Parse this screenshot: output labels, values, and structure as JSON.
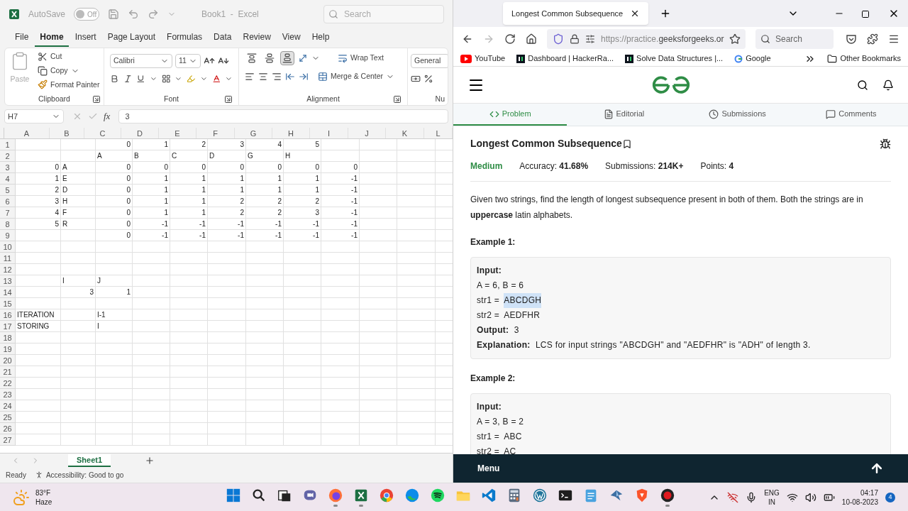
{
  "excel": {
    "title_bar": {
      "autosave_label": "AutoSave",
      "autosave_toggle": {
        "label": "Off",
        "on": false
      },
      "document_title": "Book1  -  Excel",
      "search": {
        "placeholder": "Search"
      }
    },
    "ribbon_tabs": [
      {
        "label": "File",
        "selected": false
      },
      {
        "label": "Home",
        "selected": true
      },
      {
        "label": "Insert",
        "selected": false
      },
      {
        "label": "Page Layout",
        "selected": false
      },
      {
        "label": "Formulas",
        "selected": false
      },
      {
        "label": "Data",
        "selected": false
      },
      {
        "label": "Review",
        "selected": false
      },
      {
        "label": "View",
        "selected": false
      },
      {
        "label": "Help",
        "selected": false
      }
    ],
    "ribbon": {
      "clipboard": {
        "paste": {
          "label": "Paste",
          "disabled": true
        },
        "cut": "Cut",
        "copy": "Copy",
        "format_painter": "Format Painter",
        "group_label": "Clipboard"
      },
      "font": {
        "family": "Calibri",
        "size": "11",
        "group_label": "Font"
      },
      "alignment": {
        "vertical": [
          {
            "kind": "top",
            "selected": false
          },
          {
            "kind": "middle",
            "selected": false
          },
          {
            "kind": "bottom",
            "selected": true
          }
        ],
        "wrap_text": "Wrap Text",
        "merge_center": "Merge & Center",
        "group_label": "Alignment"
      },
      "number": {
        "format": "General",
        "group_label": "Nu"
      }
    },
    "formula_bar": {
      "name_box": "H7",
      "function_label": "fx",
      "formula": "3"
    },
    "columns": [
      "A",
      "B",
      "C",
      "D",
      "E",
      "F",
      "G",
      "H",
      "I",
      "J",
      "K",
      "L"
    ],
    "rows": [
      {
        "row": "1",
        "cells": [
          null,
          null,
          {
            "text": "0",
            "kind": "number"
          },
          {
            "text": "1",
            "kind": "number"
          },
          {
            "text": "2",
            "kind": "number"
          },
          {
            "text": "3",
            "kind": "number"
          },
          {
            "text": "4",
            "kind": "number"
          },
          {
            "text": "5",
            "kind": "number"
          }
        ]
      },
      {
        "row": "2",
        "cells": [
          null,
          null,
          {
            "text": "A",
            "kind": "text"
          },
          {
            "text": "B",
            "kind": "text"
          },
          {
            "text": "C",
            "kind": "text"
          },
          {
            "text": "D",
            "kind": "text"
          },
          {
            "text": "G",
            "kind": "text"
          },
          {
            "text": "H",
            "kind": "text"
          }
        ]
      },
      {
        "row": "3",
        "cells": [
          {
            "text": "0",
            "kind": "number"
          },
          {
            "text": "A",
            "kind": "text"
          },
          {
            "text": "0",
            "kind": "number"
          },
          {
            "text": "0",
            "kind": "number"
          },
          {
            "text": "0",
            "kind": "number"
          },
          {
            "text": "0",
            "kind": "number"
          },
          {
            "text": "0",
            "kind": "number"
          },
          {
            "text": "0",
            "kind": "number"
          },
          {
            "text": "0",
            "kind": "number"
          }
        ]
      },
      {
        "row": "4",
        "cells": [
          {
            "text": "1",
            "kind": "number"
          },
          {
            "text": "E",
            "kind": "text"
          },
          {
            "text": "0",
            "kind": "number"
          },
          {
            "text": "1",
            "kind": "number"
          },
          {
            "text": "1",
            "kind": "number"
          },
          {
            "text": "1",
            "kind": "number"
          },
          {
            "text": "1",
            "kind": "number"
          },
          {
            "text": "1",
            "kind": "number"
          },
          {
            "text": "-1",
            "kind": "number"
          }
        ]
      },
      {
        "row": "5",
        "cells": [
          {
            "text": "2",
            "kind": "number"
          },
          {
            "text": "D",
            "kind": "text"
          },
          {
            "text": "0",
            "kind": "number"
          },
          {
            "text": "1",
            "kind": "number"
          },
          {
            "text": "1",
            "kind": "number"
          },
          {
            "text": "1",
            "kind": "number"
          },
          {
            "text": "1",
            "kind": "number"
          },
          {
            "text": "1",
            "kind": "number"
          },
          {
            "text": "-1",
            "kind": "number"
          }
        ]
      },
      {
        "row": "6",
        "cells": [
          {
            "text": "3",
            "kind": "number"
          },
          {
            "text": "H",
            "kind": "text"
          },
          {
            "text": "0",
            "kind": "number"
          },
          {
            "text": "1",
            "kind": "number"
          },
          {
            "text": "1",
            "kind": "number"
          },
          {
            "text": "2",
            "kind": "number"
          },
          {
            "text": "2",
            "kind": "number"
          },
          {
            "text": "2",
            "kind": "number"
          },
          {
            "text": "-1",
            "kind": "number"
          }
        ]
      },
      {
        "row": "7",
        "cells": [
          {
            "text": "4",
            "kind": "number"
          },
          {
            "text": "F",
            "kind": "text"
          },
          {
            "text": "0",
            "kind": "number"
          },
          {
            "text": "1",
            "kind": "number"
          },
          {
            "text": "1",
            "kind": "number"
          },
          {
            "text": "2",
            "kind": "number"
          },
          {
            "text": "2",
            "kind": "number"
          },
          {
            "text": "3",
            "kind": "number"
          },
          {
            "text": "-1",
            "kind": "number"
          }
        ]
      },
      {
        "row": "8",
        "cells": [
          {
            "text": "5",
            "kind": "number"
          },
          {
            "text": "R",
            "kind": "text"
          },
          {
            "text": "0",
            "kind": "number"
          },
          {
            "text": "-1",
            "kind": "number"
          },
          {
            "text": "-1",
            "kind": "number"
          },
          {
            "text": "-1",
            "kind": "number"
          },
          {
            "text": "-1",
            "kind": "number"
          },
          {
            "text": "-1",
            "kind": "number"
          },
          {
            "text": "-1",
            "kind": "number"
          }
        ]
      },
      {
        "row": "9",
        "cells": [
          null,
          null,
          {
            "text": "0",
            "kind": "number"
          },
          {
            "text": "-1",
            "kind": "number"
          },
          {
            "text": "-1",
            "kind": "number"
          },
          {
            "text": "-1",
            "kind": "number"
          },
          {
            "text": "-1",
            "kind": "number"
          },
          {
            "text": "-1",
            "kind": "number"
          },
          {
            "text": "-1",
            "kind": "number"
          }
        ]
      },
      {
        "row": "10"
      },
      {
        "row": "11"
      },
      {
        "row": "12"
      },
      {
        "row": "13",
        "cells": [
          null,
          {
            "text": "I",
            "kind": "text"
          },
          {
            "text": "J",
            "kind": "text"
          }
        ]
      },
      {
        "row": "14",
        "cells": [
          null,
          {
            "text": "3",
            "kind": "number"
          },
          {
            "text": "1",
            "kind": "number"
          }
        ]
      },
      {
        "row": "15"
      },
      {
        "row": "16",
        "cells": [
          {
            "text": "ITERATION",
            "kind": "text"
          },
          null,
          {
            "text": "I-1",
            "kind": "text"
          }
        ]
      },
      {
        "row": "17",
        "cells": [
          {
            "text": "STORING",
            "kind": "text"
          },
          null,
          {
            "text": "I",
            "kind": "text"
          }
        ]
      },
      {
        "row": "18"
      },
      {
        "row": "19"
      },
      {
        "row": "20"
      },
      {
        "row": "21"
      },
      {
        "row": "22"
      },
      {
        "row": "23"
      },
      {
        "row": "24"
      },
      {
        "row": "25"
      },
      {
        "row": "26"
      },
      {
        "row": "27"
      }
    ],
    "sheet_tabs": [
      {
        "label": "Sheet1",
        "selected": true
      }
    ],
    "status_bar": {
      "mode": "Ready",
      "accessibility": "Accessibility: Good to go"
    }
  },
  "browser": {
    "tab": {
      "title": "Longest Common Subsequence"
    },
    "navigation": {
      "back_disabled": false,
      "forward_disabled": true
    },
    "address": {
      "scheme": "https://practice.",
      "domain": "geeksforgeeks.or"
    },
    "search": {
      "placeholder": "Search"
    },
    "bookmarks": [
      {
        "kind": "video",
        "label": "YouTube"
      },
      {
        "kind": "dark",
        "label": "Dashboard | HackerRa..."
      },
      {
        "kind": "dark",
        "label": "Solve Data Structures |..."
      },
      {
        "kind": "letter",
        "label": "Google"
      }
    ],
    "other_bookmarks": "Other Bookmarks"
  },
  "page": {
    "tabs": [
      {
        "kind": "code",
        "label": "Problem",
        "selected": true
      },
      {
        "kind": "document",
        "label": "Editorial",
        "selected": false
      },
      {
        "kind": "clock",
        "label": "Submissions",
        "selected": false
      },
      {
        "kind": "comment",
        "label": "Comments",
        "selected": false
      }
    ],
    "title": "Longest Common Subsequence",
    "difficulty": "Medium",
    "stats": [
      "Accuracy: **41.68%**",
      "Submissions: **214K+**",
      "Points: **4**"
    ],
    "description": "Given two strings, find the length of longest subsequence present in both of them. Both the strings are in **uppercase** latin alphabets.",
    "examples": [
      {
        "heading": "Example 1:",
        "lines": [
          {
            "kind": "text",
            "text": "**Input:**"
          },
          {
            "kind": "text",
            "text": "A = 6, B = 6"
          },
          {
            "kind": "assign",
            "name": "str1 =",
            "value": "ABCDGH",
            "highlighted": true
          },
          {
            "kind": "assign",
            "name": "str2 =",
            "value": "AEDFHR",
            "highlighted": false
          },
          {
            "kind": "text",
            "text": "**Output:**  3"
          },
          {
            "kind": "text",
            "text": "**Explanation:**  LCS for input strings \"ABCDGH\" and \"AEDFHR\" is \"ADH\" of length 3."
          }
        ]
      },
      {
        "heading": "Example 2:",
        "lines": [
          {
            "kind": "text",
            "text": "**Input:**"
          },
          {
            "kind": "text",
            "text": "A = 3, B = 2"
          },
          {
            "kind": "assign",
            "name": "str1 =",
            "value": "ABC",
            "highlighted": false
          },
          {
            "kind": "assign",
            "name": "str2 =",
            "value": "AC",
            "highlighted": false
          }
        ]
      }
    ],
    "menu_bar": {
      "label": "Menu"
    }
  },
  "taskbar": {
    "weather": {
      "temperature": "83°F",
      "condition": "Haze"
    },
    "apps": [
      {
        "kind": "windows",
        "running": false
      },
      {
        "kind": "search",
        "running": false
      },
      {
        "kind": "taskview",
        "running": false
      },
      {
        "kind": "chat",
        "running": false
      },
      {
        "kind": "firefox",
        "running": true
      },
      {
        "kind": "excel",
        "running": true
      },
      {
        "kind": "chrome",
        "running": false
      },
      {
        "kind": "edge",
        "running": false
      },
      {
        "kind": "music",
        "running": false
      },
      {
        "kind": "folder",
        "running": false
      },
      {
        "kind": "code",
        "running": false
      },
      {
        "kind": "calculator",
        "running": false
      },
      {
        "kind": "web",
        "running": false
      },
      {
        "kind": "terminal",
        "running": false
      },
      {
        "kind": "notepad",
        "running": false
      },
      {
        "kind": "bird",
        "running": false
      },
      {
        "kind": "shield",
        "running": false
      },
      {
        "kind": "record",
        "running": true
      }
    ],
    "tray": {
      "language": "ENG",
      "region": "IN",
      "time": "04:17",
      "date": "10-08-2023",
      "notifications": "4"
    }
  }
}
